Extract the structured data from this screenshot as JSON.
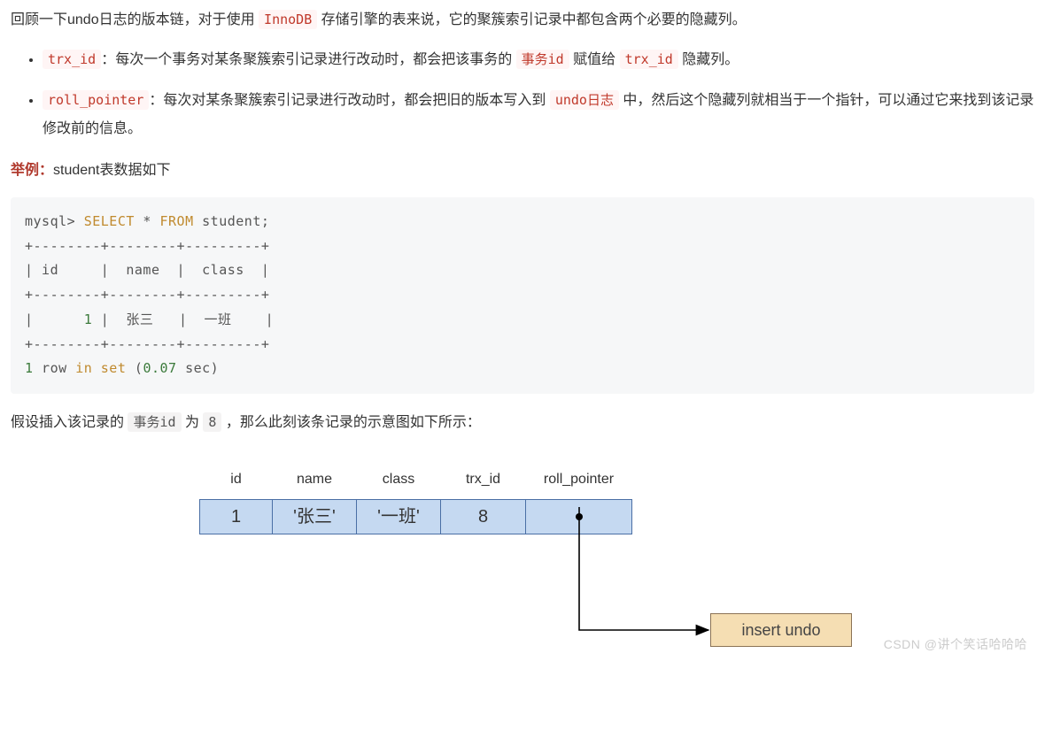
{
  "intro": {
    "prefix": "回顾一下undo日志的版本链，对于使用 ",
    "code": "InnoDB",
    "suffix": " 存储引擎的表来说，它的聚簇索引记录中都包含两个必要的隐藏列。"
  },
  "bullets": [
    {
      "code1": "trx_id",
      "text1": "：每次一个事务对某条聚簇索引记录进行改动时，都会把该事务的 ",
      "code2": "事务id",
      "text2": " 赋值给 ",
      "code3": "trx_id",
      "text3": " 隐藏列。"
    },
    {
      "code1": "roll_pointer",
      "text1": "：每次对某条聚簇索引记录进行改动时，都会把旧的版本写入到 ",
      "code2": "undo日志",
      "text2": " 中，然后这个隐藏列就相当于一个指针，可以通过它来找到该记录修改前的信息。"
    }
  ],
  "example_label": "举例：",
  "example_text": "student表数据如下",
  "sql": "mysql> SELECT * FROM student;\n+--------+--------+---------+\n| id     |  name  |  class  |\n+--------+--------+---------+\n|      1 |  张三   |  一班    |\n+--------+--------+---------+\n1 row in set (0.07 sec)",
  "assume": {
    "t1": "假设插入该记录的 ",
    "code1": "事务id",
    "t2": " 为 ",
    "code2": "8",
    "t3": " ，那么此刻该条记录的示意图如下所示："
  },
  "chart_data": {
    "type": "table",
    "headers": [
      "id",
      "name",
      "class",
      "trx_id",
      "roll_pointer"
    ],
    "row": {
      "id": "1",
      "name": "'张三'",
      "class": "'一班'",
      "trx_id": "8",
      "roll_pointer": ""
    },
    "pointer_target": "insert undo"
  },
  "watermark": "CSDN @讲个笑话哈哈哈"
}
